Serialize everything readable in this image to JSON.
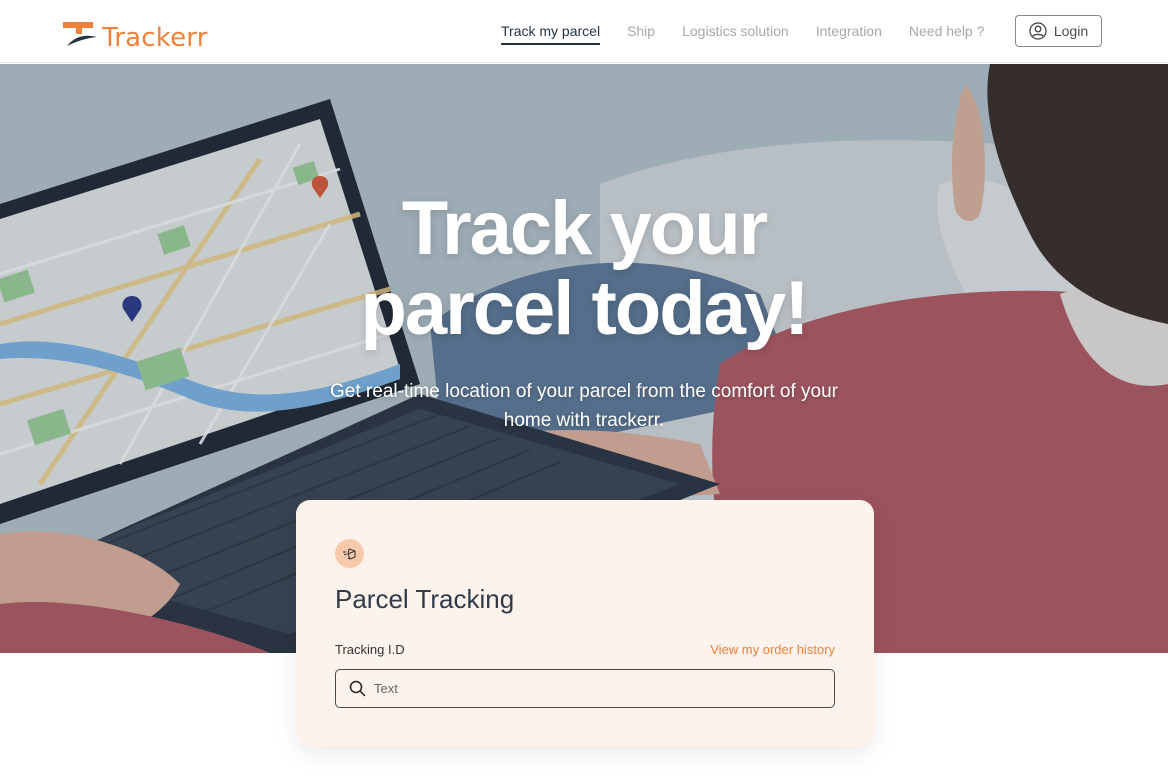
{
  "brand": {
    "name": "Trackerr",
    "accent": "#f0813a",
    "dark": "#263342"
  },
  "nav": {
    "items": [
      {
        "label": "Track my parcel",
        "active": true
      },
      {
        "label": "Ship",
        "active": false
      },
      {
        "label": "Logistics solution",
        "active": false
      },
      {
        "label": "Integration",
        "active": false
      },
      {
        "label": "Need help ?",
        "active": false
      }
    ],
    "login_label": "Login",
    "login_icon": "user-circle-icon"
  },
  "hero": {
    "title_line1": "Track your",
    "title_line2": "parcel today!",
    "subtitle": "Get real-time location of your parcel from the comfort of your home with trackerr."
  },
  "tracking_card": {
    "icon": "parcel-box-icon",
    "title": "Parcel Tracking",
    "field_label": "Tracking I.D",
    "history_link": "View my order history",
    "search_icon": "search-icon",
    "placeholder": "Text",
    "value": ""
  }
}
